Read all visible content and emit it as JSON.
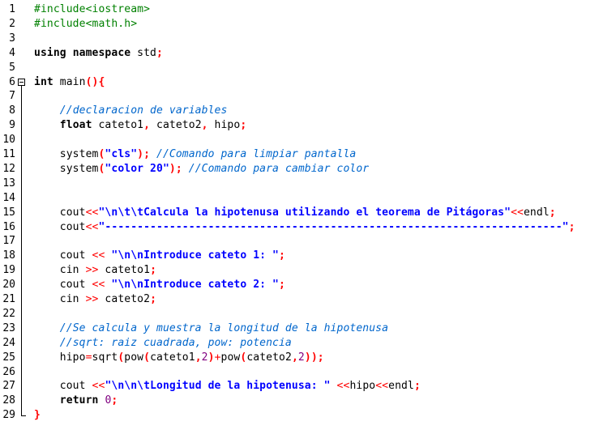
{
  "editor": {
    "fold_start_line": 6,
    "fold_end_line": 29,
    "colors": {
      "preprocessor": "#008000",
      "keyword": "#000000",
      "bracket": "#ff0000",
      "string": "#0000ff",
      "comment": "#0066cc",
      "number": "#800080",
      "operator": "#ff0000",
      "text": "#000000"
    },
    "lines": [
      {
        "num": "1",
        "tokens": [
          {
            "t": "#include<iostream>",
            "k": "pre"
          }
        ]
      },
      {
        "num": "2",
        "tokens": [
          {
            "t": "#include<math.h>",
            "k": "pre"
          }
        ]
      },
      {
        "num": "3",
        "tokens": []
      },
      {
        "num": "4",
        "tokens": [
          {
            "t": "using",
            "k": "kw"
          },
          {
            "t": " ",
            "k": "id"
          },
          {
            "t": "namespace",
            "k": "kw"
          },
          {
            "t": " std",
            "k": "id"
          },
          {
            "t": ";",
            "k": "br"
          }
        ]
      },
      {
        "num": "5",
        "tokens": []
      },
      {
        "num": "6",
        "tokens": [
          {
            "t": "int",
            "k": "kw"
          },
          {
            "t": " main",
            "k": "id"
          },
          {
            "t": "(){",
            "k": "br"
          }
        ]
      },
      {
        "num": "7",
        "tokens": []
      },
      {
        "num": "8",
        "tokens": [
          {
            "t": "    ",
            "k": "id"
          },
          {
            "t": "//declaracion de variables",
            "k": "cmt"
          }
        ]
      },
      {
        "num": "9",
        "tokens": [
          {
            "t": "    ",
            "k": "id"
          },
          {
            "t": "float",
            "k": "kw"
          },
          {
            "t": " cateto1",
            "k": "id"
          },
          {
            "t": ",",
            "k": "br"
          },
          {
            "t": " cateto2",
            "k": "id"
          },
          {
            "t": ",",
            "k": "br"
          },
          {
            "t": " hipo",
            "k": "id"
          },
          {
            "t": ";",
            "k": "br"
          }
        ]
      },
      {
        "num": "10",
        "tokens": []
      },
      {
        "num": "11",
        "tokens": [
          {
            "t": "    system",
            "k": "id"
          },
          {
            "t": "(",
            "k": "br"
          },
          {
            "t": "\"cls\"",
            "k": "str"
          },
          {
            "t": ");",
            "k": "br"
          },
          {
            "t": " ",
            "k": "id"
          },
          {
            "t": "//Comando para limpiar pantalla",
            "k": "cmt"
          }
        ]
      },
      {
        "num": "12",
        "tokens": [
          {
            "t": "    system",
            "k": "id"
          },
          {
            "t": "(",
            "k": "br"
          },
          {
            "t": "\"color 20\"",
            "k": "str"
          },
          {
            "t": ");",
            "k": "br"
          },
          {
            "t": " ",
            "k": "id"
          },
          {
            "t": "//Comando para cambiar color",
            "k": "cmt"
          }
        ]
      },
      {
        "num": "13",
        "tokens": []
      },
      {
        "num": "14",
        "tokens": []
      },
      {
        "num": "15",
        "tokens": [
          {
            "t": "    cout",
            "k": "id"
          },
          {
            "t": "<<",
            "k": "op"
          },
          {
            "t": "\"\\n\\t\\tCalcula la hipotenusa utilizando el teorema de Pitágoras\"",
            "k": "str"
          },
          {
            "t": "<<",
            "k": "op"
          },
          {
            "t": "endl",
            "k": "id"
          },
          {
            "t": ";",
            "k": "br"
          }
        ]
      },
      {
        "num": "16",
        "tokens": [
          {
            "t": "    cout",
            "k": "id"
          },
          {
            "t": "<<",
            "k": "op"
          },
          {
            "t": "\"-----------------------------------------------------------------------\"",
            "k": "str"
          },
          {
            "t": ";",
            "k": "br"
          }
        ]
      },
      {
        "num": "17",
        "tokens": []
      },
      {
        "num": "18",
        "tokens": [
          {
            "t": "    cout ",
            "k": "id"
          },
          {
            "t": "<<",
            "k": "op"
          },
          {
            "t": " ",
            "k": "id"
          },
          {
            "t": "\"\\n\\nIntroduce cateto 1: \"",
            "k": "str"
          },
          {
            "t": ";",
            "k": "br"
          }
        ]
      },
      {
        "num": "19",
        "tokens": [
          {
            "t": "    cin ",
            "k": "id"
          },
          {
            "t": ">>",
            "k": "op"
          },
          {
            "t": " cateto1",
            "k": "id"
          },
          {
            "t": ";",
            "k": "br"
          }
        ]
      },
      {
        "num": "20",
        "tokens": [
          {
            "t": "    cout ",
            "k": "id"
          },
          {
            "t": "<<",
            "k": "op"
          },
          {
            "t": " ",
            "k": "id"
          },
          {
            "t": "\"\\n\\nIntroduce cateto 2: \"",
            "k": "str"
          },
          {
            "t": ";",
            "k": "br"
          }
        ]
      },
      {
        "num": "21",
        "tokens": [
          {
            "t": "    cin ",
            "k": "id"
          },
          {
            "t": ">>",
            "k": "op"
          },
          {
            "t": " cateto2",
            "k": "id"
          },
          {
            "t": ";",
            "k": "br"
          }
        ]
      },
      {
        "num": "22",
        "tokens": []
      },
      {
        "num": "23",
        "tokens": [
          {
            "t": "    ",
            "k": "id"
          },
          {
            "t": "//Se calcula y muestra la longitud de la hipotenusa",
            "k": "cmt"
          }
        ]
      },
      {
        "num": "24",
        "tokens": [
          {
            "t": "    ",
            "k": "id"
          },
          {
            "t": "//sqrt: raiz cuadrada, pow: potencia",
            "k": "cmt"
          }
        ]
      },
      {
        "num": "25",
        "tokens": [
          {
            "t": "    hipo",
            "k": "id"
          },
          {
            "t": "=",
            "k": "op"
          },
          {
            "t": "sqrt",
            "k": "id"
          },
          {
            "t": "(",
            "k": "br"
          },
          {
            "t": "pow",
            "k": "id"
          },
          {
            "t": "(",
            "k": "br"
          },
          {
            "t": "cateto1",
            "k": "id"
          },
          {
            "t": ",",
            "k": "br"
          },
          {
            "t": "2",
            "k": "num"
          },
          {
            "t": ")",
            "k": "br"
          },
          {
            "t": "+",
            "k": "op"
          },
          {
            "t": "pow",
            "k": "id"
          },
          {
            "t": "(",
            "k": "br"
          },
          {
            "t": "cateto2",
            "k": "id"
          },
          {
            "t": ",",
            "k": "br"
          },
          {
            "t": "2",
            "k": "num"
          },
          {
            "t": "));",
            "k": "br"
          }
        ]
      },
      {
        "num": "26",
        "tokens": []
      },
      {
        "num": "27",
        "tokens": [
          {
            "t": "    cout ",
            "k": "id"
          },
          {
            "t": "<<",
            "k": "op"
          },
          {
            "t": "\"\\n\\n\\tLongitud de la hipotenusa: \"",
            "k": "str"
          },
          {
            "t": " ",
            "k": "id"
          },
          {
            "t": "<<",
            "k": "op"
          },
          {
            "t": "hipo",
            "k": "id"
          },
          {
            "t": "<<",
            "k": "op"
          },
          {
            "t": "endl",
            "k": "id"
          },
          {
            "t": ";",
            "k": "br"
          }
        ]
      },
      {
        "num": "28",
        "tokens": [
          {
            "t": "    ",
            "k": "id"
          },
          {
            "t": "return",
            "k": "kw"
          },
          {
            "t": " ",
            "k": "id"
          },
          {
            "t": "0",
            "k": "num"
          },
          {
            "t": ";",
            "k": "br"
          }
        ]
      },
      {
        "num": "29",
        "tokens": [
          {
            "t": "}",
            "k": "br"
          }
        ]
      }
    ]
  }
}
